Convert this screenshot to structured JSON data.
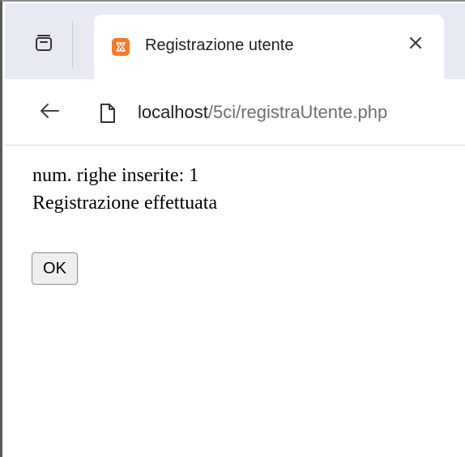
{
  "browser": {
    "tab": {
      "title": "Registrazione utente",
      "favicon": "xampp-favicon",
      "close_icon": "close-icon"
    },
    "tab_actions_icon": "tab-search-icon",
    "address_bar": {
      "back_icon": "back-arrow-icon",
      "page_icon": "page-info-icon",
      "host": "localhost",
      "path": "/5ci/registraUtente.php"
    }
  },
  "page": {
    "line1": "num. righe inserite: 1",
    "line2": "Registrazione effettuata",
    "ok_label": "OK"
  },
  "colors": {
    "tabstrip_bg": "#e7eaf2",
    "favicon": "#f37a2a",
    "url_path": "#6b6f76"
  }
}
